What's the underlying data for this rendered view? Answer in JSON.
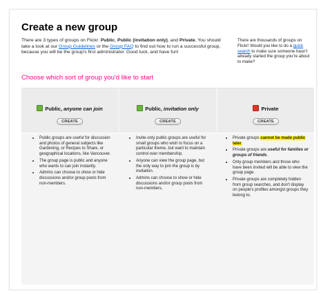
{
  "page_title": "Create a new group",
  "intro": {
    "t1": "There are 3 types of groups on Flickr: ",
    "b1": "Public",
    "t2": ", ",
    "b2": "Public (invitation only)",
    "t3": ", and ",
    "b3": "Private",
    "t4": ". You should take a look at our ",
    "link1": "Group Guidelines",
    "t5": " or the ",
    "link2": "Group FAQ",
    "t6": " to find out how to run a successful group, because you will be the group's first administrator. Good luck, and have fun!"
  },
  "aside": {
    "t1": "There are thousands of groups on Flickr! Would you like to do a ",
    "link": "quick search",
    "t2": " to make sure someone hasn't already started the group you're about to make?"
  },
  "choose_heading": "Choose which sort of group you'd like to start",
  "columns": [
    {
      "title_plain": "Public, ",
      "title_italic": "anyone can join",
      "button": "CREATE",
      "bullets": [
        {
          "t": "Public groups are useful for discussion and photos of general subjects like Gardening, or Recipes to Share, or geographical locations, like Vancouver."
        },
        {
          "t": "The group page is public and anyone who wants to can join instantly."
        },
        {
          "t": "Admins can choose to show or hide discussions and/or group pools from non-members."
        }
      ]
    },
    {
      "title_plain": "Public, ",
      "title_italic": "invitation only",
      "button": "CREATE",
      "bullets": [
        {
          "t": "Invite-only public groups are useful for small groups who wish to focus on a particular theme, but want to maintain control over membership."
        },
        {
          "t": "Anyone can view the group page, but the only way to join the group is by invitation."
        },
        {
          "t": "Admins can choose to show or hide discussions and/or group pools from non-members."
        }
      ]
    },
    {
      "title_plain": "Private",
      "button": "CREATE",
      "b1_pre": "Private groups ",
      "b1_hl": "cannot be made public later",
      "b1_post": ".",
      "b2_pre": "Private groups are ",
      "b2_em": "useful for families or groups of friends",
      "b2_post": ".",
      "b3": "Only group members and those who have been invited will be able to view the group page.",
      "b4": "Private groups are completely hidden from group searches, and don't display on people's profiles amongst groups they belong to."
    }
  ],
  "colors": {
    "accent_pink": "#ff0084",
    "link_blue": "#0063dc",
    "public_badge": "#6cb33f",
    "private_badge": "#e0352b",
    "highlight": "#fff200"
  },
  "icons": [
    "public-group-icon",
    "invite-group-icon",
    "private-group-icon"
  ]
}
